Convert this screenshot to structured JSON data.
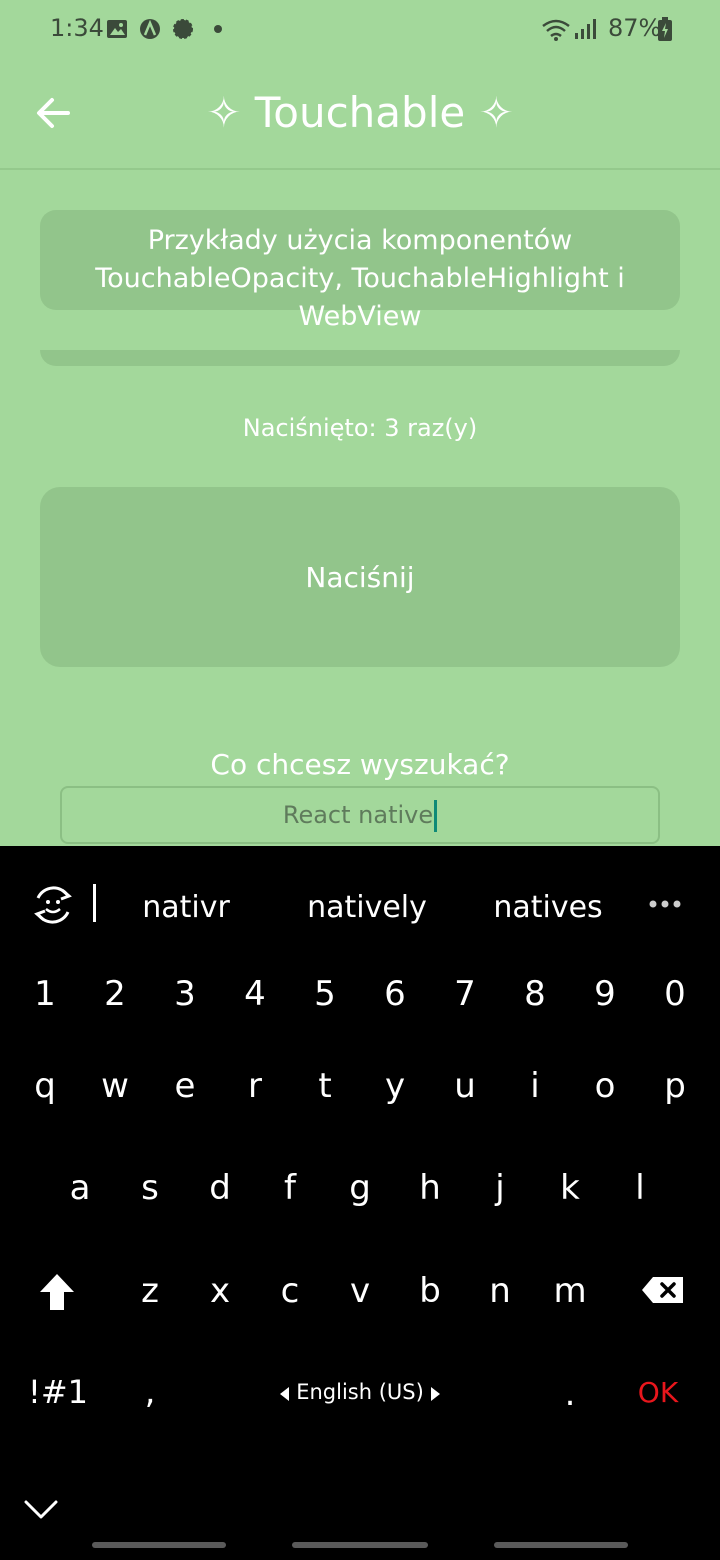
{
  "status_bar": {
    "time": "1:34",
    "battery": "87%",
    "icons": [
      "image-icon",
      "a-circle-icon",
      "signal-app-icon",
      "dot-icon",
      "wifi-icon",
      "cell-signal-icon",
      "battery-charging-icon"
    ]
  },
  "app_bar": {
    "title": "✧ Touchable ✧",
    "back_icon": "arrow-left-icon"
  },
  "content": {
    "header_line1": "Przykłady użycia komponentów",
    "header_line2": "TouchableOpacity, TouchableHighlight i WebView",
    "press_count": "Naciśnięto: 3 raz(y)",
    "press_button_label": "Naciśnij",
    "search_label": "Co chcesz wyszukać?",
    "search_value": "React native"
  },
  "keyboard": {
    "suggestions": [
      "nativr",
      "natively",
      "natives"
    ],
    "number_row": [
      "1",
      "2",
      "3",
      "4",
      "5",
      "6",
      "7",
      "8",
      "9",
      "0"
    ],
    "row_q": [
      "q",
      "w",
      "e",
      "r",
      "t",
      "y",
      "u",
      "i",
      "o",
      "p"
    ],
    "row_a": [
      "a",
      "s",
      "d",
      "f",
      "g",
      "h",
      "j",
      "k",
      "l"
    ],
    "row_z": [
      "z",
      "x",
      "c",
      "v",
      "b",
      "n",
      "m"
    ],
    "symbols_key": "!#1",
    "comma_key": ",",
    "language": "English (US)",
    "period_key": ".",
    "ok_key": "OK"
  },
  "colors": {
    "background": "#a3d89b",
    "card": "#92c58b",
    "ok_red": "#e8161c",
    "cursor": "#0f8a77"
  }
}
